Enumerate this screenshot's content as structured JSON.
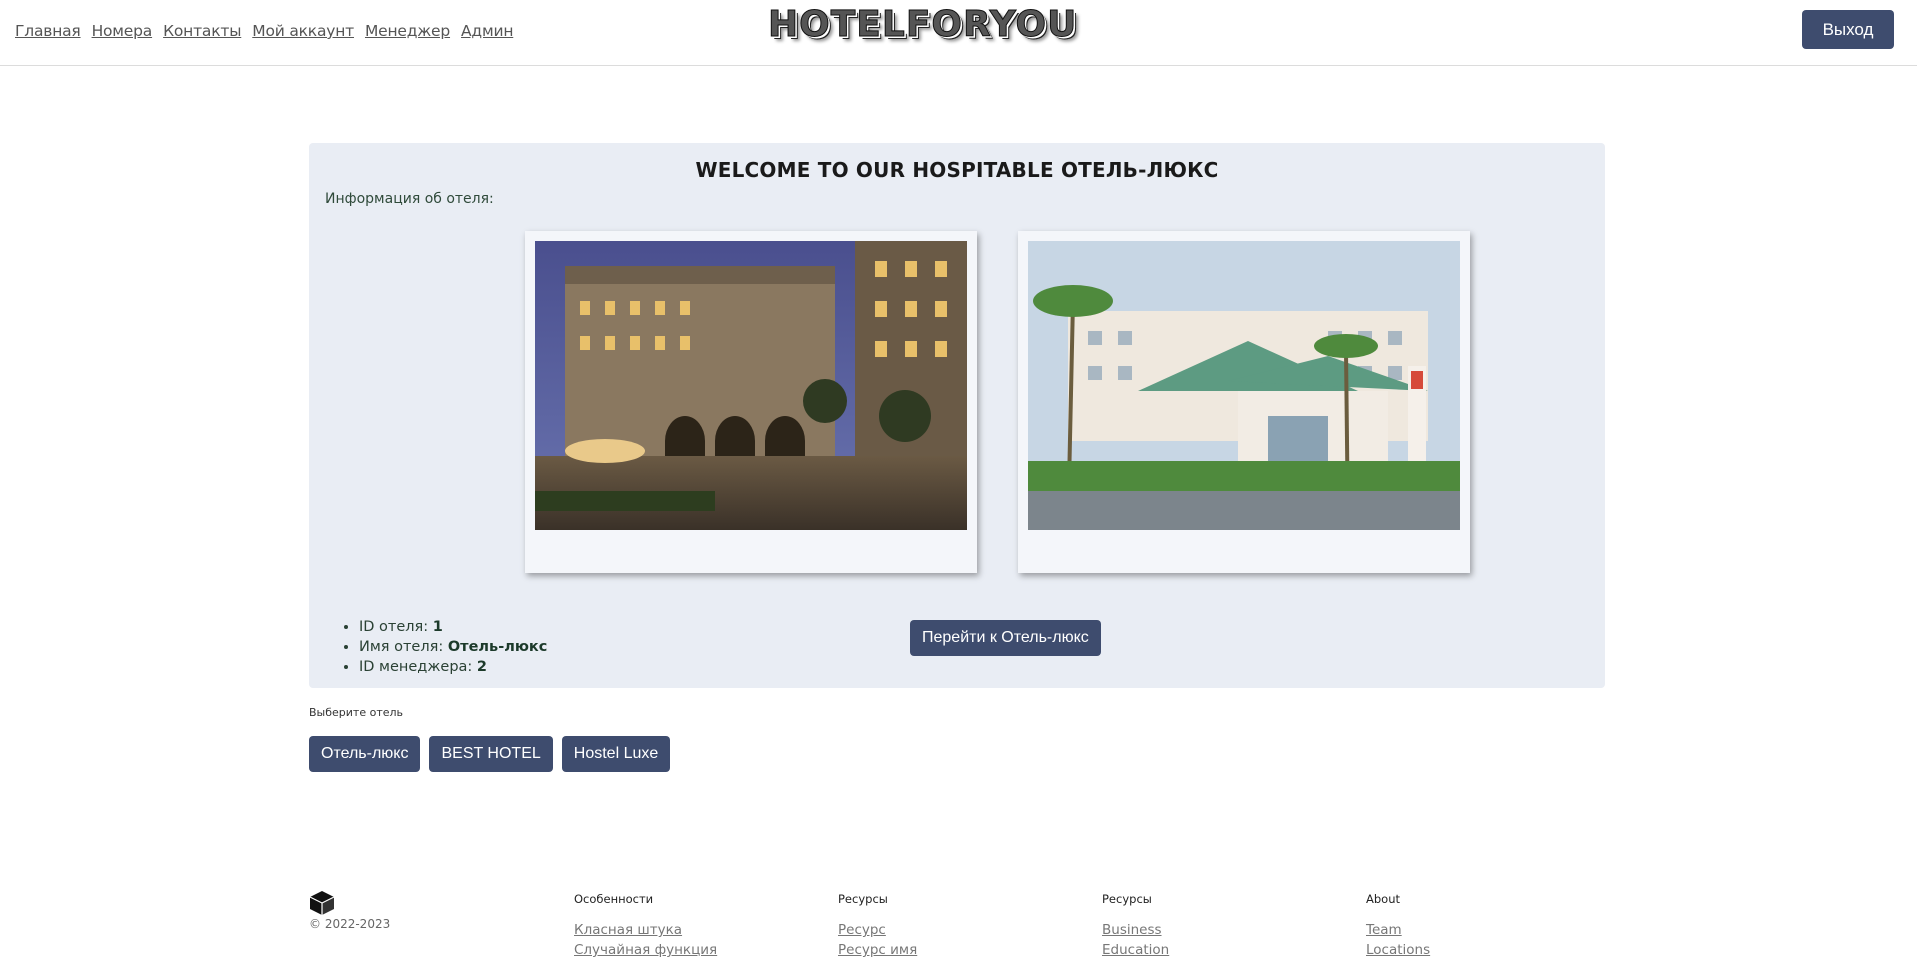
{
  "header": {
    "nav": [
      "Главная",
      "Номера",
      "Контакты",
      "Мой аккаунт",
      "Менеджер",
      "Админ"
    ],
    "logo": "HOTELFORYOU",
    "logout_label": "Выход"
  },
  "panel": {
    "title": "WELCOME TO OUR HOSPITABLE ОТЕЛЬ-ЛЮКС",
    "info_label": "Информация об отеля:",
    "facts": {
      "id_label": "ID отеля: ",
      "id_value": "1",
      "name_label": "Имя отеля: ",
      "name_value": "Отель-люкс",
      "manager_label": "ID менеджера: ",
      "manager_value": "2"
    },
    "go_label": "Перейти к Отель-люкс"
  },
  "select": {
    "label": "Выберите отель",
    "hotels": [
      "Отель-люкс",
      "BEST HOTEL",
      "Hostel Luxe"
    ]
  },
  "footer": {
    "logo_icon": "cube-icon",
    "copyright": "© 2022-2023",
    "columns": [
      {
        "title": "Особенности",
        "links": [
          "Класная штука",
          "Случайная функция"
        ]
      },
      {
        "title": "Ресурсы",
        "links": [
          "Ресурс",
          "Ресурс имя"
        ]
      },
      {
        "title": "Ресурсы",
        "links": [
          "Business",
          "Education"
        ]
      },
      {
        "title": "About",
        "links": [
          "Team",
          "Locations"
        ]
      }
    ]
  },
  "colors": {
    "accent": "#3e4c6e",
    "panel_bg": "#e9edf4"
  }
}
